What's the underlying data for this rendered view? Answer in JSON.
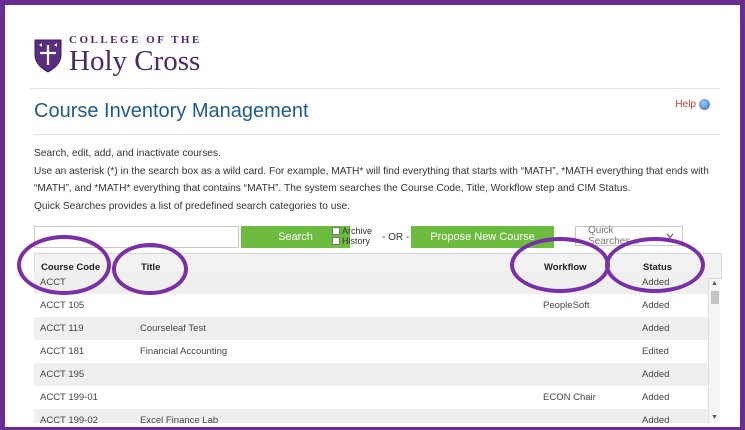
{
  "logo": {
    "line1": "COLLEGE OF THE",
    "line2": "Holy Cross"
  },
  "page": {
    "title": "Course Inventory Management",
    "help": "Help"
  },
  "instructions": {
    "line1": "Search, edit, add, and inactivate courses.",
    "line2": "Use an asterisk (*) in the search box as a wild card. For example, MATH* will find everything that starts with “MATH”, *MATH everything that ends with “MATH”, and *MATH* everything that contains “MATH”. The system searches the Course Code, Title, Workflow step and CIM Status.",
    "line3": "Quick Searches provides a list of predefined search categories to use."
  },
  "search": {
    "input_value": "",
    "button": "Search",
    "archive": "Archive",
    "history": "History",
    "or": "- OR -",
    "propose": "Propose New Course",
    "quick_searches": "Quick Searches..."
  },
  "table": {
    "headers": {
      "code": "Course Code",
      "title": "Title",
      "workflow": "Workflow",
      "status": "Status"
    },
    "rows": [
      {
        "code": "ACCT",
        "title": "",
        "workflow": "",
        "status": "Added"
      },
      {
        "code": "ACCT 105",
        "title": "",
        "workflow": "PeopleSoft",
        "status": "Added"
      },
      {
        "code": "ACCT 119",
        "title": "Courseleaf Test",
        "workflow": "",
        "status": "Added"
      },
      {
        "code": "ACCT 181",
        "title": "Financial Accounting",
        "workflow": "",
        "status": "Edited"
      },
      {
        "code": "ACCT 195",
        "title": "",
        "workflow": "",
        "status": "Added"
      },
      {
        "code": "ACCT 199-01",
        "title": "",
        "workflow": "ECON Chair",
        "status": "Added"
      },
      {
        "code": "ACCT 199-02",
        "title": "Excel Finance Lab",
        "workflow": "",
        "status": "Added"
      }
    ]
  },
  "colors": {
    "brand_purple": "#4b2768",
    "annotation_purple": "#7a2fa8",
    "button_green": "#6dbb3f",
    "title_blue": "#1f5a8c"
  }
}
